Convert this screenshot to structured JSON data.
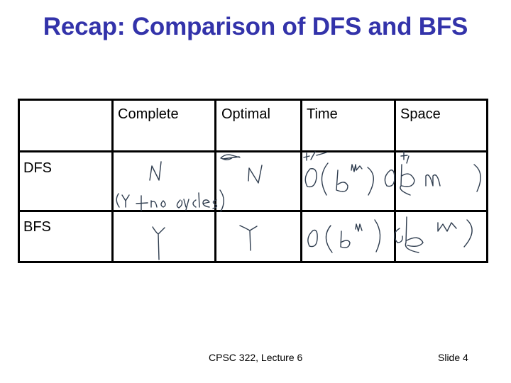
{
  "slide": {
    "title": "Recap: Comparison of DFS and BFS",
    "table": {
      "columns": [
        "",
        "Complete",
        "Optimal",
        "Time",
        "Space"
      ],
      "rows": [
        {
          "label": "DFS",
          "handwritten": {
            "complete": "N",
            "complete_note": "(Y + no cycles)",
            "optimal": "N",
            "time_prefix": "+/-",
            "time": "O(b^m)",
            "space_prefix": "+",
            "space": "O(bm)"
          }
        },
        {
          "label": "BFS",
          "handwritten": {
            "complete": "Y",
            "optimal": "Y",
            "time": "O(b^m)",
            "space": "O(b^m)"
          }
        }
      ]
    },
    "footer": {
      "course": "CPSC 322, Lecture 6",
      "slide_number": "Slide 4"
    },
    "colors": {
      "title": "#3333aa",
      "ink": "#2f3d4f",
      "grid": "#000000"
    }
  }
}
